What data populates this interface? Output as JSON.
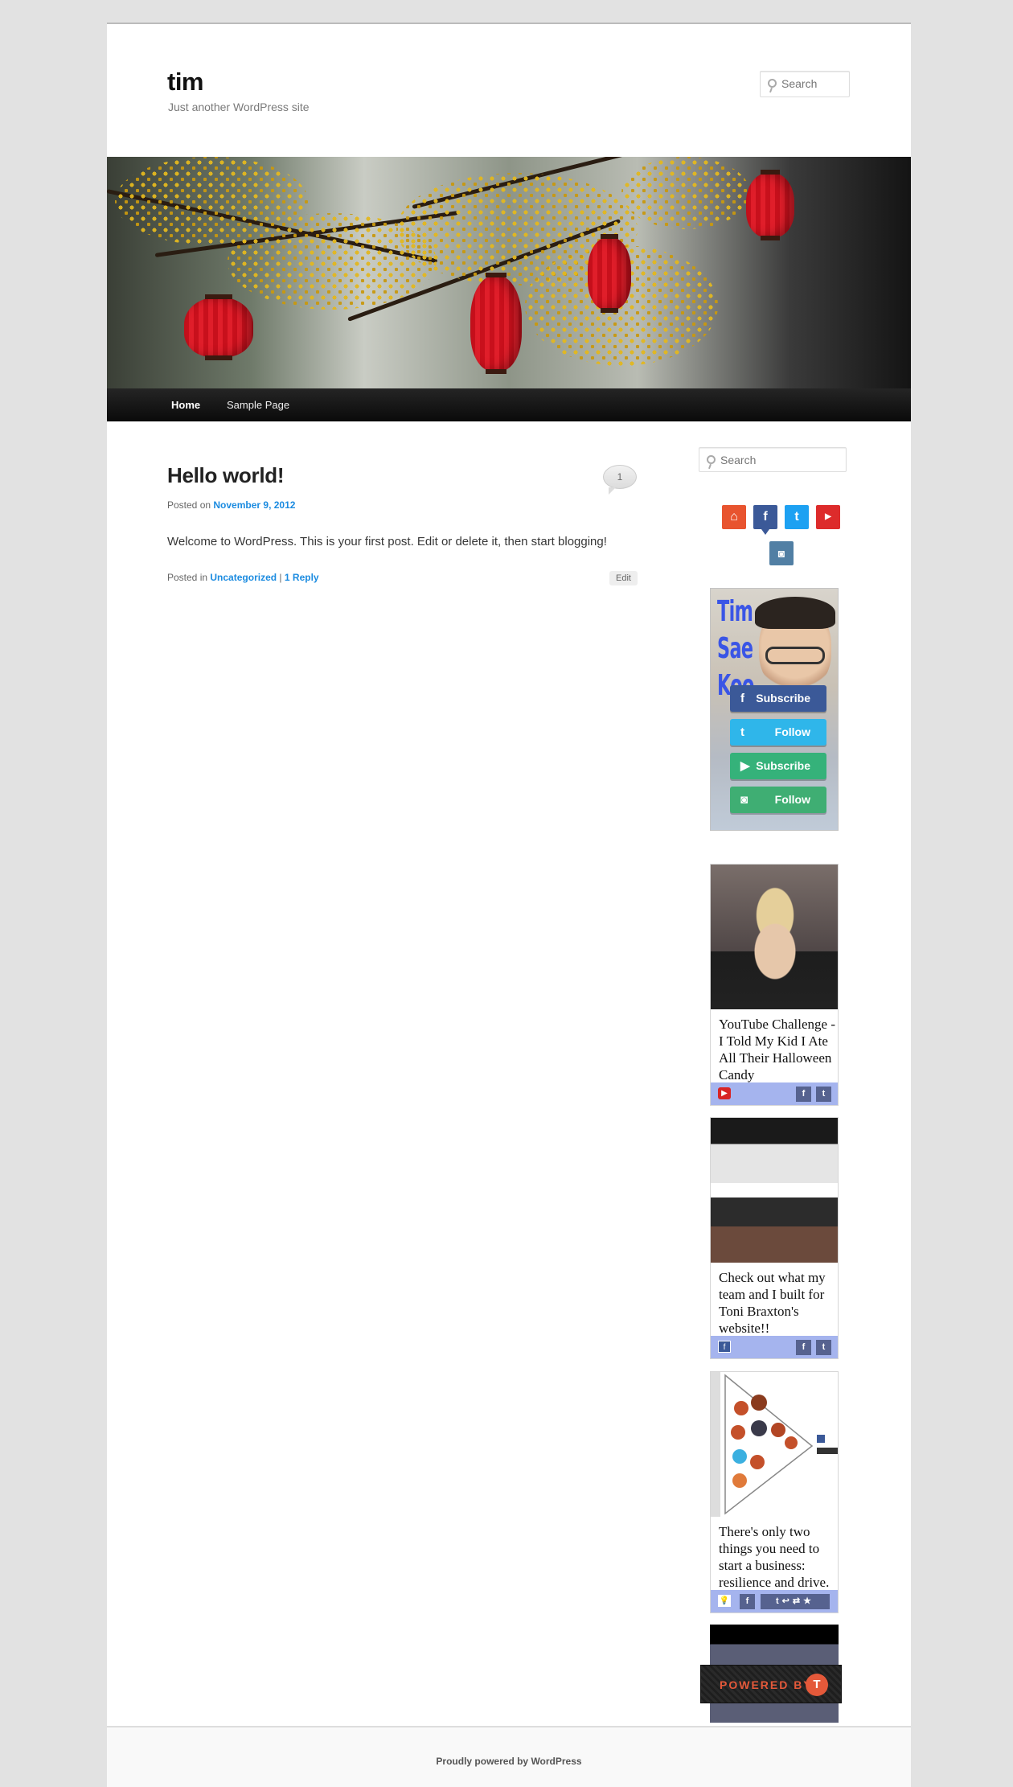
{
  "site": {
    "title": "tim",
    "description": "Just another WordPress site"
  },
  "header_search": {
    "placeholder": "Search"
  },
  "nav": {
    "items": [
      {
        "label": "Home"
      },
      {
        "label": "Sample Page"
      }
    ]
  },
  "post": {
    "title": "Hello world!",
    "comment_count": "1",
    "posted_on_label": "Posted on",
    "date": "November 9, 2012",
    "body": "Welcome to WordPress. This is your first post. Edit or delete it, then start blogging!",
    "posted_in_label": "Posted in",
    "category": "Uncategorized",
    "separator": "|",
    "reply_link": "1 Reply",
    "edit_label": "Edit"
  },
  "sidebar": {
    "search": {
      "placeholder": "Search"
    },
    "social_icons": [
      "home-icon",
      "facebook-icon",
      "twitter-icon",
      "youtube-icon",
      "instagram-icon"
    ],
    "profile": {
      "name": "Tim Sae Koo",
      "buttons": [
        {
          "icon": "facebook-icon",
          "label": "Subscribe"
        },
        {
          "icon": "twitter-icon",
          "label": "Follow"
        },
        {
          "icon": "youtube-icon",
          "label": "Subscribe"
        },
        {
          "icon": "instagram-icon",
          "label": "Follow"
        }
      ]
    },
    "cards": [
      {
        "text": "YouTube Challenge - I Told My Kid I Ate All Their Halloween Candy",
        "source_icon": "youtube-icon"
      },
      {
        "text": "Check out what my team and I built for Toni Braxton's website!!",
        "source_icon": "facebook-icon"
      },
      {
        "text": "There's only two things you need to start a business: resilience and drive.",
        "source_icon": "lightbulb-icon"
      }
    ],
    "powered_by": "POWERED BY"
  },
  "footer": {
    "text": "Proudly powered by WordPress"
  },
  "colors": {
    "accent": "#1b8be0",
    "nav_bg": "#111111",
    "card_bar": "#a5b4ee",
    "profile_name": "#3a55e6",
    "powered_orange": "#e4593a"
  }
}
